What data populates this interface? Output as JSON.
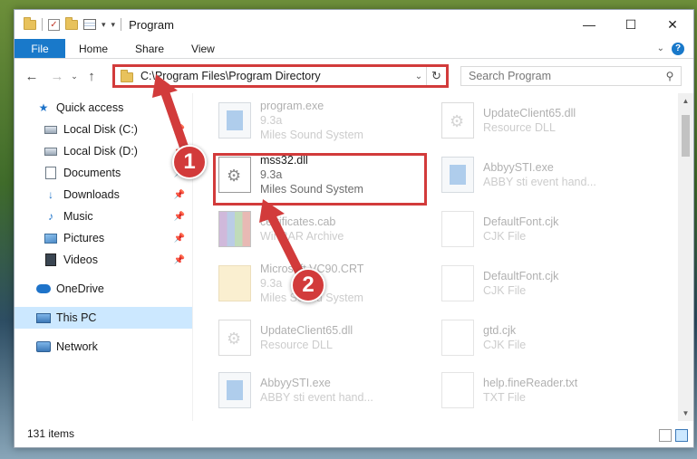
{
  "window": {
    "title": "Program",
    "controls": {
      "minimize": "—",
      "maximize": "☐",
      "close": "✕"
    }
  },
  "ribbon": {
    "tabs": [
      {
        "label": "File"
      },
      {
        "label": "Home"
      },
      {
        "label": "Share"
      },
      {
        "label": "View"
      }
    ],
    "help": "?"
  },
  "nav": {
    "back": "←",
    "forward": "→",
    "recent": "⌄",
    "up": "↑"
  },
  "address": {
    "path": "C:\\Program Files\\Program Directory",
    "refresh": "↻"
  },
  "search": {
    "placeholder": "Search Program"
  },
  "sidebar": {
    "items": [
      {
        "label": "Quick access",
        "icon": "star-icon"
      },
      {
        "label": "Local Disk (C:)",
        "icon": "drive-icon",
        "pinned": true
      },
      {
        "label": "Local Disk (D:)",
        "icon": "drive-icon",
        "pinned": true
      },
      {
        "label": "Documents",
        "icon": "documents-icon",
        "pinned": true
      },
      {
        "label": "Downloads",
        "icon": "download-icon",
        "pinned": true
      },
      {
        "label": "Music",
        "icon": "music-icon",
        "pinned": true
      },
      {
        "label": "Pictures",
        "icon": "pictures-icon",
        "pinned": true
      },
      {
        "label": "Videos",
        "icon": "videos-icon",
        "pinned": true
      },
      {
        "label": "OneDrive",
        "icon": "onedrive-icon"
      },
      {
        "label": "This PC",
        "icon": "computer-icon",
        "selected": true
      },
      {
        "label": "Network",
        "icon": "network-icon"
      }
    ]
  },
  "files": [
    {
      "name": "program.exe",
      "line2": "9.3a",
      "line3": "Miles Sound System",
      "icon": "exe-icon",
      "faded": true
    },
    {
      "name": "UpdateClient65.dll",
      "line2": "Resource DLL",
      "line3": "",
      "icon": "dll-icon",
      "faded": true
    },
    {
      "name": "mss32.dll",
      "line2": "9.3a",
      "line3": "Miles Sound System",
      "icon": "dll-icon",
      "faded": false,
      "highlighted": true
    },
    {
      "name": "AbbyySTI.exe",
      "line2": "ABBY sti event hand...",
      "line3": "",
      "icon": "exe-icon",
      "faded": true
    },
    {
      "name": "certificates.cab",
      "line2": "WinRAR Archive",
      "line3": "",
      "icon": "cab-icon",
      "faded": true
    },
    {
      "name": "DefaultFont.cjk",
      "line2": "CJK File",
      "line3": "",
      "icon": "blank-file-icon",
      "faded": true
    },
    {
      "name": "Microsoft.VC90.CRT",
      "line2": "9.3a",
      "line3": "Miles Sound System",
      "icon": "folder-icon",
      "faded": true
    },
    {
      "name": "DefaultFont.cjk",
      "line2": "CJK File",
      "line3": "",
      "icon": "blank-file-icon",
      "faded": true
    },
    {
      "name": "UpdateClient65.dll",
      "line2": "Resource DLL",
      "line3": "",
      "icon": "dll-icon",
      "faded": true
    },
    {
      "name": "gtd.cjk",
      "line2": "CJK File",
      "line3": "",
      "icon": "blank-file-icon",
      "faded": true
    },
    {
      "name": "AbbyySTI.exe",
      "line2": "ABBY sti event hand...",
      "line3": "",
      "icon": "exe-icon",
      "faded": true
    },
    {
      "name": "help.fineReader.txt",
      "line2": "TXT File",
      "line3": "",
      "icon": "blank-file-icon",
      "faded": true
    }
  ],
  "status": {
    "item_count": "131 items"
  },
  "annotations": {
    "step1": "1",
    "step2": "2",
    "color": "#d23b3b"
  }
}
